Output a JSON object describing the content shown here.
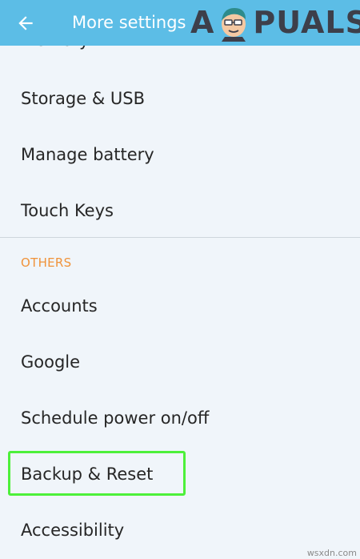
{
  "appbar": {
    "back_icon": "arrow-back-icon",
    "title": "More settings",
    "color": "#5cbde6"
  },
  "watermark": {
    "text": "APPUALS",
    "letter_a": "A",
    "letters_rest": "PUALS"
  },
  "list": {
    "partial_item": "Memory",
    "items_before": [
      "Storage & USB",
      "Manage battery",
      "Touch Keys"
    ],
    "section_header": "OTHERS",
    "items_after": [
      "Accounts",
      "Google",
      "Schedule power on/off",
      "Backup & Reset",
      "Accessibility"
    ],
    "highlighted_item": "Backup & Reset",
    "highlight_color": "#4df03a",
    "header_color": "#f0933a"
  },
  "credit": "wsxdn.com"
}
